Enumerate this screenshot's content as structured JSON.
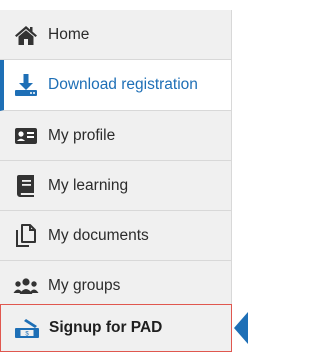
{
  "menu": {
    "items": [
      {
        "label": "Home",
        "icon": "home-icon"
      },
      {
        "label": "Download registration",
        "icon": "download-icon"
      },
      {
        "label": "My profile",
        "icon": "profile-card-icon"
      },
      {
        "label": "My learning",
        "icon": "book-icon"
      },
      {
        "label": "My documents",
        "icon": "documents-icon"
      },
      {
        "label": "My groups",
        "icon": "users-icon"
      },
      {
        "label": "Signup for PAD",
        "icon": "signup-icon"
      }
    ],
    "active_item": "Download registration",
    "highlighted_item": "Signup for PAD"
  },
  "colors": {
    "accent": "#1e6fb6",
    "icon": "#333333",
    "highlight_border": "#e0574f",
    "item_background": "#f0f0f0"
  }
}
